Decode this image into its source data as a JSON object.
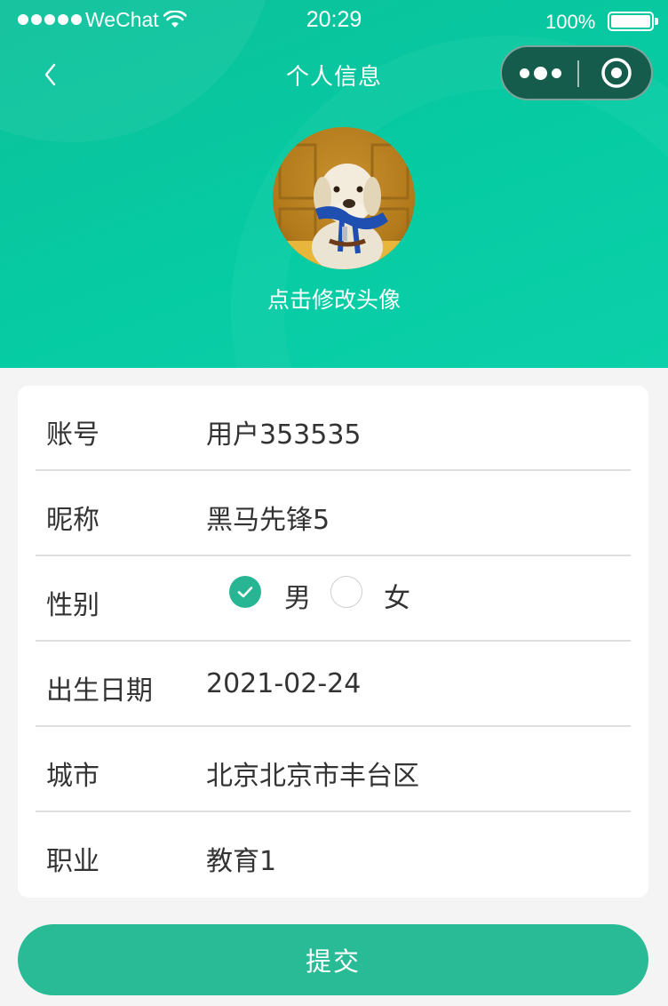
{
  "status_bar": {
    "carrier": "WeChat",
    "time": "20:29",
    "battery": "100%"
  },
  "nav": {
    "title": "个人信息",
    "back_icon": "chevron-left-icon",
    "more_icon": "more-dots-icon",
    "close_icon": "target-close-icon"
  },
  "avatar": {
    "label": "点击修改头像"
  },
  "form": {
    "account": {
      "label": "账号",
      "value": "用户353535"
    },
    "nickname": {
      "label": "昵称",
      "value": "黑马先锋5"
    },
    "gender": {
      "label": "性别",
      "options": [
        {
          "label": "男",
          "checked": true
        },
        {
          "label": "女",
          "checked": false
        }
      ]
    },
    "birthday": {
      "label": "出生日期",
      "value": "2021-02-24"
    },
    "city": {
      "label": "城市",
      "value": "北京北京市丰台区"
    },
    "job": {
      "label": "职业",
      "value": "教育1"
    }
  },
  "submit": {
    "label": "提交"
  },
  "colors": {
    "header": "#06cba3",
    "accent": "#28bb96",
    "capsule": "#155c4c",
    "background": "#f4f4f4"
  }
}
